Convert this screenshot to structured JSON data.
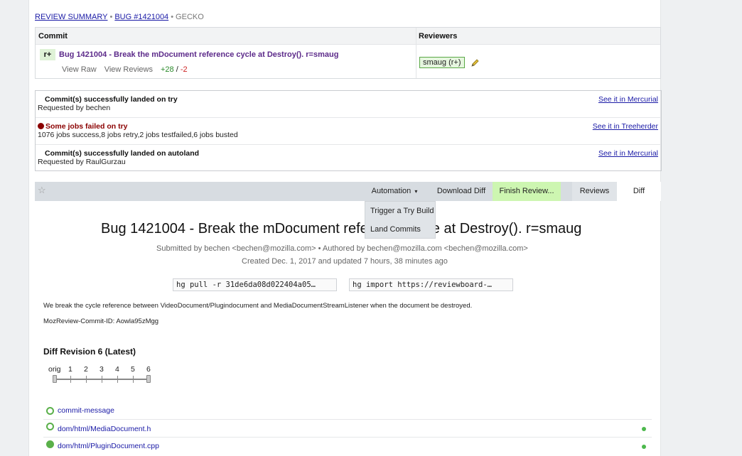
{
  "breadcrumb": {
    "review_summary": "REVIEW SUMMARY",
    "sep1": "•",
    "bug": "BUG #1421004",
    "sep2": "•",
    "product": "GECKO"
  },
  "commits": {
    "header_commit": "Commit",
    "header_reviewers": "Reviewers",
    "status_badge": "r+",
    "title": "Bug 1421004 - Break the mDocument reference cycle at Destroy(). r=smaug",
    "view_raw": "View Raw",
    "view_reviews": "View Reviews",
    "additions": "+28",
    "slash": "/",
    "deletions": "-2",
    "reviewer": "smaug (r+)"
  },
  "statuses": [
    {
      "title": "Commit(s) successfully landed on try",
      "sub": "Requested by bechen",
      "link": "See it in Mercurial"
    },
    {
      "title": "Some jobs failed on try",
      "sub": "1076 jobs success,8 jobs retry,2 jobs testfailed,6 jobs busted",
      "link": "See it in Treeherder"
    },
    {
      "title": "Commit(s) successfully landed on autoland",
      "sub": "Requested by RaulGurzau",
      "link": "See it in Mercurial"
    }
  ],
  "toolbar": {
    "star": "☆",
    "automation": "Automation",
    "automation_caret": "▾",
    "download_diff": "Download Diff",
    "finish_review": "Finish Review...",
    "reviews_tab": "Reviews",
    "diff_tab": "Diff"
  },
  "automation_menu": {
    "items": [
      "Trigger a Try Build",
      "Land Commits"
    ]
  },
  "review": {
    "title": "Bug 1421004 - Break the mDocument reference cycle at Destroy(). r=smaug",
    "submitted": "Submitted by bechen <bechen@mozilla.com> • Authored by bechen@mozilla.com <bechen@mozilla.com>",
    "created": "Created Dec. 1, 2017 and updated 7 hours, 38 minutes ago",
    "pull_cmd": "hg pull -r 31de6da08d022404a05…",
    "import_cmd": "hg import https://reviewboard-…",
    "description": "We break the cycle reference between VideoDocument/Plugindocument and MediaDocumentStreamListener when the document be destroyed.",
    "commit_id": "MozReview-Commit-ID: Aowla95zMgg"
  },
  "diff_revision": {
    "title": "Diff Revision 6 (Latest)",
    "labels": [
      "orig",
      "1",
      "2",
      "3",
      "4",
      "5",
      "6"
    ],
    "selected_range": [
      "orig",
      "6"
    ]
  },
  "files": [
    {
      "name": "commit-message",
      "status": "open",
      "marker": false
    },
    {
      "name": "dom/html/MediaDocument.h",
      "status": "open",
      "marker": true
    },
    {
      "name": "dom/html/PluginDocument.cpp",
      "status": "filled",
      "marker": true
    }
  ],
  "colors": {
    "accent_link": "#1a1aa6",
    "finish_green": "#cdf6b1",
    "fail_red": "#8b0000",
    "ok_green": "#5ab04a"
  }
}
